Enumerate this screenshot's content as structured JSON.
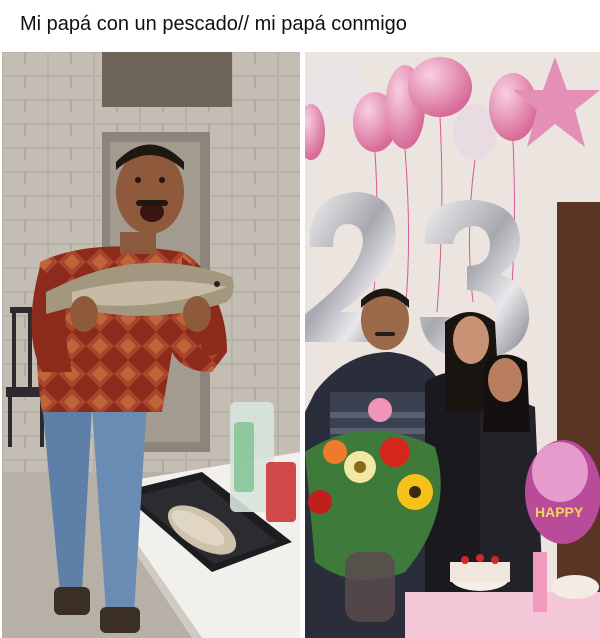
{
  "post": {
    "caption": "Mi papá con un pescado// mi papá conmigo"
  },
  "photos": {
    "left": {
      "icon": "photo-father-fish"
    },
    "right": {
      "icon": "photo-father-daughters-balloons",
      "balloon_number": "23",
      "party_balloon_text": "HAPPY"
    }
  },
  "colors": {
    "caption_text": "#111111",
    "background": "#ffffff"
  }
}
